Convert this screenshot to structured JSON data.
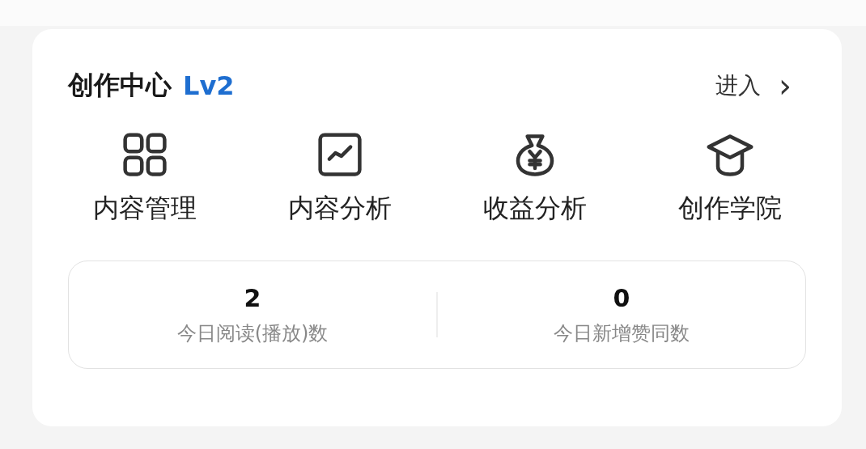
{
  "card": {
    "title": "创作中心",
    "level": "Lv2",
    "enter": "进入",
    "enter_arrow": "›",
    "shortcuts": [
      {
        "kind": "grid",
        "label": "内容管理"
      },
      {
        "kind": "chart",
        "label": "内容分析"
      },
      {
        "kind": "moneybag",
        "label": "收益分析"
      },
      {
        "kind": "cap",
        "label": "创作学院"
      }
    ],
    "stats": [
      {
        "value": "2",
        "label": "今日阅读(播放)数"
      },
      {
        "value": "0",
        "label": "今日新增赞同数"
      }
    ]
  }
}
